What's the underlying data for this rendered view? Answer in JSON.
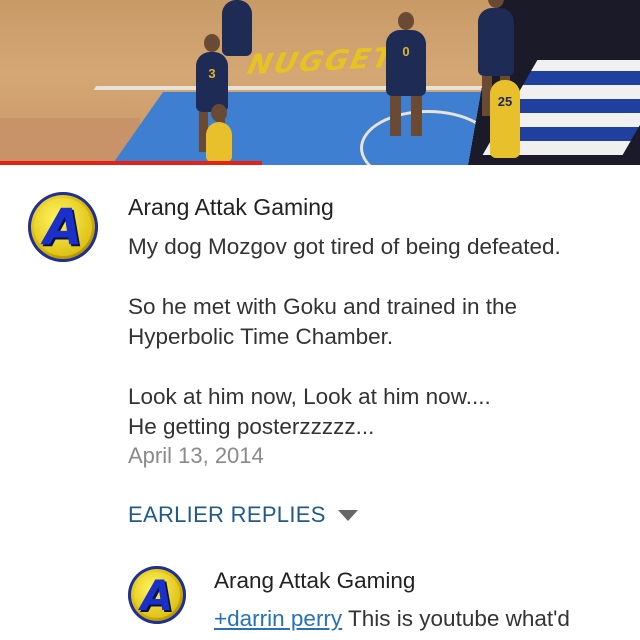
{
  "video": {
    "court_logo_text": "NUGGETS",
    "players": [
      {
        "number": "3",
        "jersey": "#1d2b55"
      },
      {
        "number": "0",
        "jersey": "#1d2b55"
      },
      {
        "number": "",
        "jersey": "#1d2b55"
      },
      {
        "number": "25",
        "jersey": "#e7c02b"
      }
    ],
    "progress": 0.41,
    "progress_color": "#e62117"
  },
  "comment": {
    "avatar_letter": "A",
    "author": "Arang Attak Gaming",
    "paragraphs": [
      [
        "My dog Mozgov got tired of being defeated."
      ],
      [
        "So he met with Goku and trained in the",
        "Hyperbolic Time Chamber."
      ],
      [
        "Look at him now, Look at him now....",
        "He getting posterzzzzz..."
      ]
    ],
    "date": "April 13, 2014"
  },
  "earlier_replies": {
    "label": "EARLIER REPLIES",
    "icon": "caret-down-icon"
  },
  "reply": {
    "avatar_letter": "A",
    "author": "Arang Attak Gaming",
    "mention": "+darrin perry",
    "text": " This is youtube what'd"
  },
  "colors": {
    "link": "#2672b8",
    "section_link": "#1f5a8a",
    "date": "#8a8a8a"
  }
}
